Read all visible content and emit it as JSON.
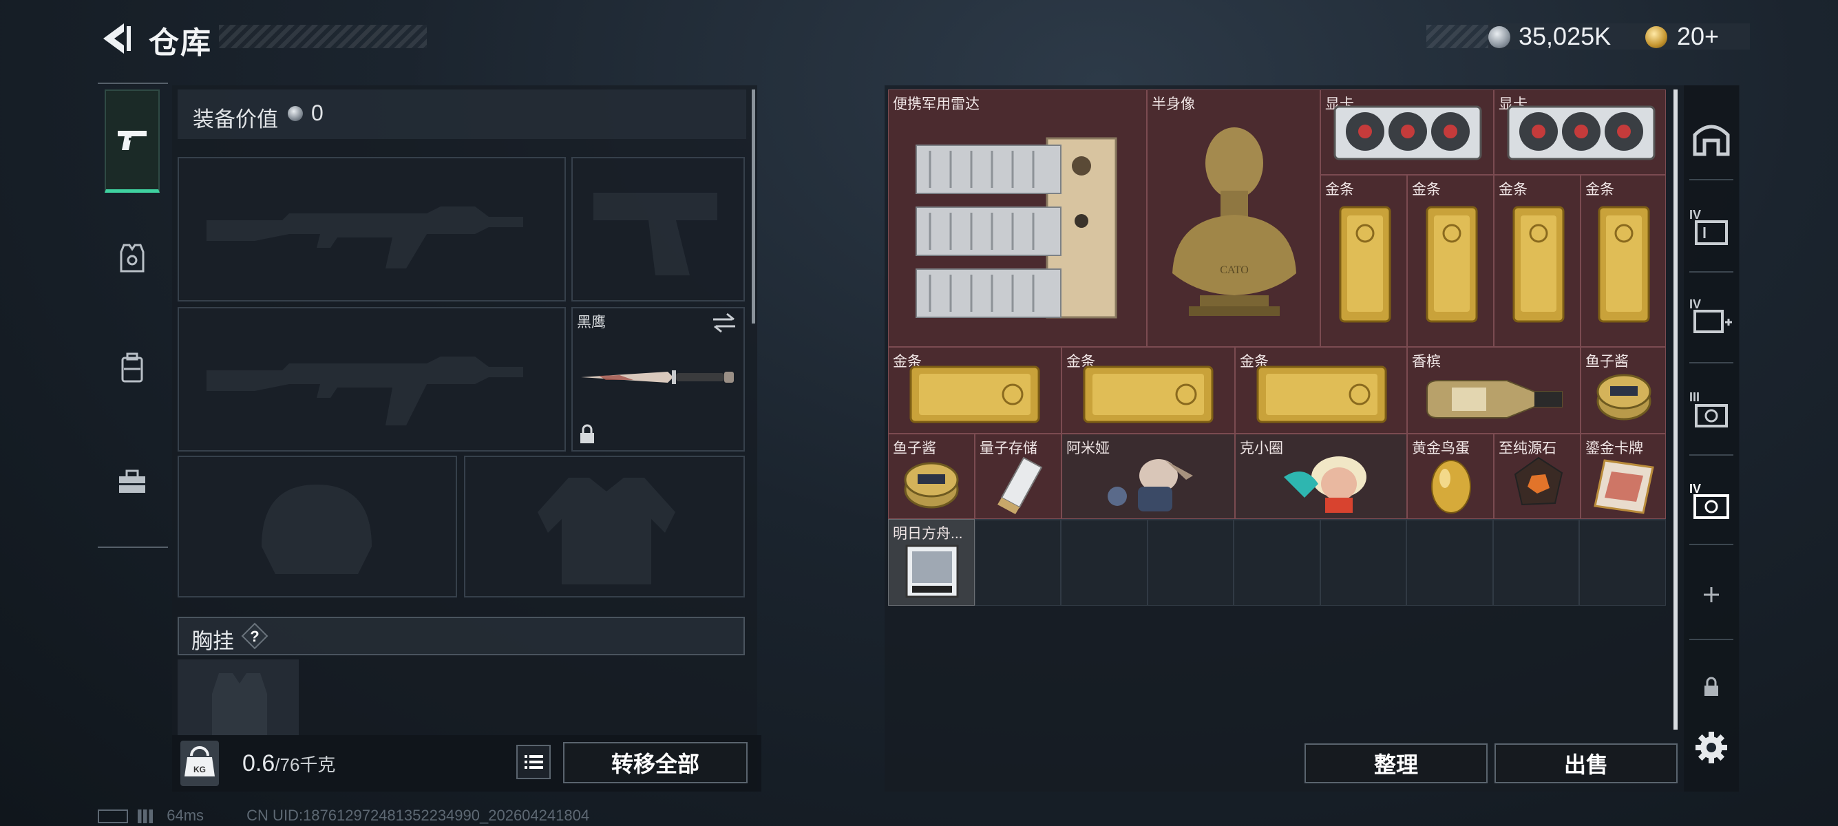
{
  "header": {
    "title": "仓库"
  },
  "currency": {
    "silver": "35,025K",
    "gold": "20+"
  },
  "left_tabs": [
    {
      "name": "weapon-tab-icon"
    },
    {
      "name": "vest-tab-icon"
    },
    {
      "name": "backpack-tab-icon"
    },
    {
      "name": "toolbox-tab-icon"
    }
  ],
  "equipment": {
    "value_label": "装备价值",
    "value": "0",
    "melee_label": "黑鹰",
    "chest_rig_label": "胸挂",
    "chest_rig_help": "?",
    "weight": "0.6",
    "weight_max": "/76千克",
    "transfer_all": "转移全部"
  },
  "stash": {
    "items": [
      {
        "label": "便携军用雷达",
        "icon": "radar"
      },
      {
        "label": "半身像",
        "icon": "bust"
      },
      {
        "label": "显卡",
        "icon": "gpu"
      },
      {
        "label": "显卡",
        "icon": "gpu"
      },
      {
        "label": "金条",
        "icon": "gold-bar"
      },
      {
        "label": "金条",
        "icon": "gold-bar"
      },
      {
        "label": "金条",
        "icon": "gold-bar"
      },
      {
        "label": "金条",
        "icon": "gold-bar"
      },
      {
        "label": "金条",
        "icon": "gold-bar-wide"
      },
      {
        "label": "金条",
        "icon": "gold-bar-wide"
      },
      {
        "label": "金条",
        "icon": "gold-bar-wide"
      },
      {
        "label": "香槟",
        "icon": "champagne"
      },
      {
        "label": "鱼子酱",
        "icon": "caviar"
      },
      {
        "label": "鱼子酱",
        "icon": "caviar"
      },
      {
        "label": "量子存储",
        "icon": "usb-drive"
      },
      {
        "label": "阿米娅",
        "icon": "figure"
      },
      {
        "label": "克小圈",
        "icon": "figure"
      },
      {
        "label": "黄金鸟蛋",
        "icon": "golden-egg"
      },
      {
        "label": "至纯源石",
        "icon": "gem"
      },
      {
        "label": "鎏金卡牌",
        "icon": "card"
      },
      {
        "label": "明日方舟...",
        "icon": "cd-album"
      }
    ],
    "sort_button": "整理",
    "sell_button": "出售"
  },
  "right_tabs": [
    {
      "name": "stash-tab-icon"
    },
    {
      "name": "stash-page-iv-icon"
    },
    {
      "name": "stash-page-iv-med-icon"
    },
    {
      "name": "stash-page-iii-icon"
    },
    {
      "name": "stash-page-iv-active-icon"
    },
    {
      "name": "add-page-icon"
    },
    {
      "name": "lock-icon"
    },
    {
      "name": "settings-gear-icon"
    }
  ],
  "status": {
    "ping": "64ms",
    "uid": "CN UID:187612972481352234990_202604241804"
  }
}
